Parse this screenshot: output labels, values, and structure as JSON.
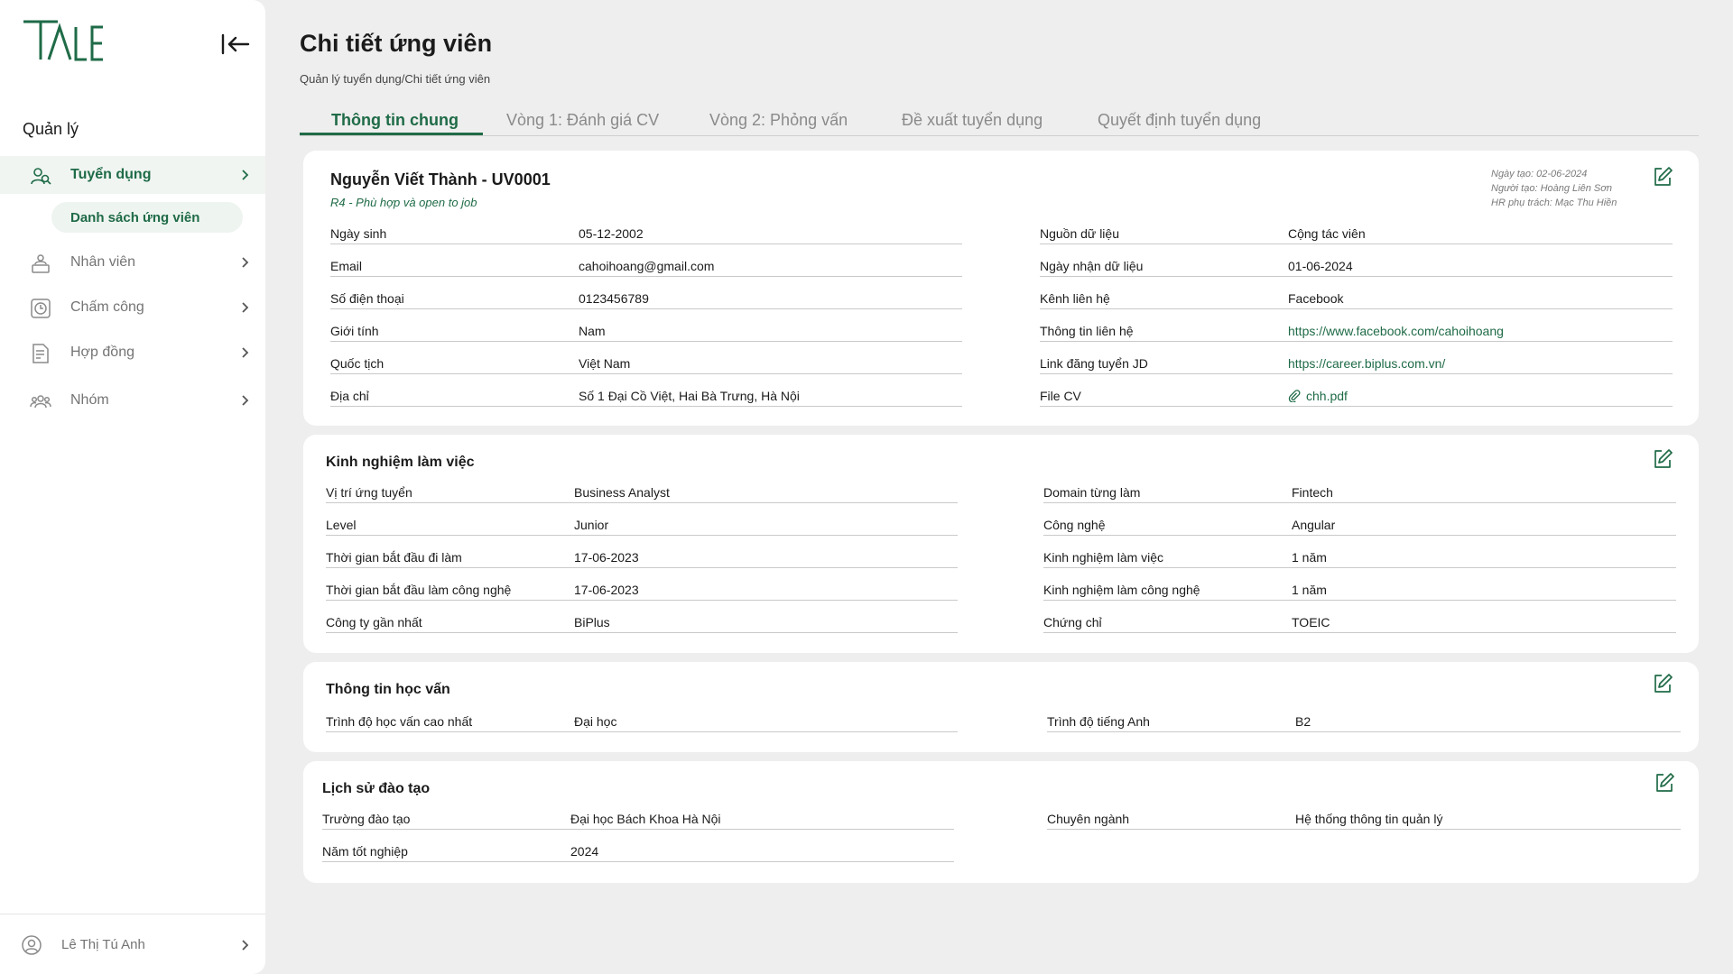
{
  "sidebar": {
    "section_label": "Quản lý",
    "items": [
      {
        "label": "Tuyển dụng",
        "icon": "recruitment-icon",
        "active": true
      },
      {
        "label": "Nhân viên",
        "icon": "employee-icon"
      },
      {
        "label": "Chấm công",
        "icon": "clock-icon"
      },
      {
        "label": "Hợp đồng",
        "icon": "contract-icon"
      },
      {
        "label": "Nhóm",
        "icon": "group-icon"
      }
    ],
    "sub_item": "Danh sách ứng viên",
    "user_name": "Lê Thị Tú Anh"
  },
  "header": {
    "title": "Chi tiết ứng viên",
    "breadcrumb": "Quản lý tuyển dụng/Chi tiết ứng viên"
  },
  "tabs": [
    {
      "label": "Thông tin chung",
      "active": true
    },
    {
      "label": "Vòng 1: Đánh giá CV"
    },
    {
      "label": "Vòng 2: Phỏng vấn"
    },
    {
      "label": "Đề xuất tuyển dụng"
    },
    {
      "label": "Quyết định tuyển dụng"
    }
  ],
  "candidate": {
    "name": "Nguyễn Viết Thành - UV0001",
    "status": "R4 - Phù hợp và open to job",
    "meta_created": "Ngày tạo: 02-06-2024",
    "meta_creator": "Người tạo: Hoàng Liên Sơn",
    "meta_hr": "HR phụ trách: Mạc Thu Hiền",
    "left_fields": [
      {
        "label": "Ngày sinh",
        "value": "05-12-2002"
      },
      {
        "label": "Email",
        "value": "cahoihoang@gmail.com"
      },
      {
        "label": "Số điện thoại",
        "value": "0123456789"
      },
      {
        "label": "Giới tính",
        "value": "Nam"
      },
      {
        "label": "Quốc tịch",
        "value": "Việt Nam"
      },
      {
        "label": "Địa chỉ",
        "value": "Số 1 Đại Cồ Việt, Hai Bà Trưng, Hà Nội"
      }
    ],
    "right_fields": [
      {
        "label": "Nguồn dữ liệu",
        "value": "Cộng tác viên"
      },
      {
        "label": "Ngày nhận dữ liệu",
        "value": "01-06-2024"
      },
      {
        "label": "Kênh liên hệ",
        "value": "Facebook"
      },
      {
        "label": "Thông tin liên hệ",
        "value": "https://www.facebook.com/cahoihoang"
      },
      {
        "label": "Link đăng tuyển JD",
        "value": "https://career.biplus.com.vn/"
      },
      {
        "label": "File CV",
        "value": "chh.pdf"
      }
    ]
  },
  "experience": {
    "title": "Kinh nghiệm làm việc",
    "left_fields": [
      {
        "label": "Vị trí ứng tuyển",
        "value": "Business Analyst"
      },
      {
        "label": "Level",
        "value": "Junior"
      },
      {
        "label": "Thời gian bắt đầu đi làm",
        "value": "17-06-2023"
      },
      {
        "label": "Thời gian bắt đầu làm công nghệ",
        "value": "17-06-2023"
      },
      {
        "label": "Công ty gần nhất",
        "value": "BiPlus"
      }
    ],
    "right_fields": [
      {
        "label": "Domain từng làm",
        "value": "Fintech"
      },
      {
        "label": "Công nghệ",
        "value": "Angular"
      },
      {
        "label": "Kinh nghiệm làm việc",
        "value": "1 năm"
      },
      {
        "label": "Kinh nghiệm làm công nghệ",
        "value": "1 năm"
      },
      {
        "label": "Chứng chỉ",
        "value": "TOEIC"
      }
    ]
  },
  "education": {
    "title": "Thông tin học vấn",
    "left_fields": [
      {
        "label": "Trình độ học vấn cao nhất",
        "value": "Đại học"
      }
    ],
    "right_fields": [
      {
        "label": "Trình độ tiếng Anh",
        "value": "B2"
      }
    ]
  },
  "training": {
    "title": "Lịch sử đào tạo",
    "left_fields": [
      {
        "label": "Trường đào tạo",
        "value": "Đại học Bách Khoa Hà Nội"
      },
      {
        "label": "Năm tốt nghiệp",
        "value": "2024"
      }
    ],
    "right_fields": [
      {
        "label": "Chuyên ngành",
        "value": "Hệ thống thông tin quản lý"
      }
    ]
  },
  "colors": {
    "accent": "#1f6b47",
    "background": "#eeeeee",
    "card": "#ffffff"
  }
}
